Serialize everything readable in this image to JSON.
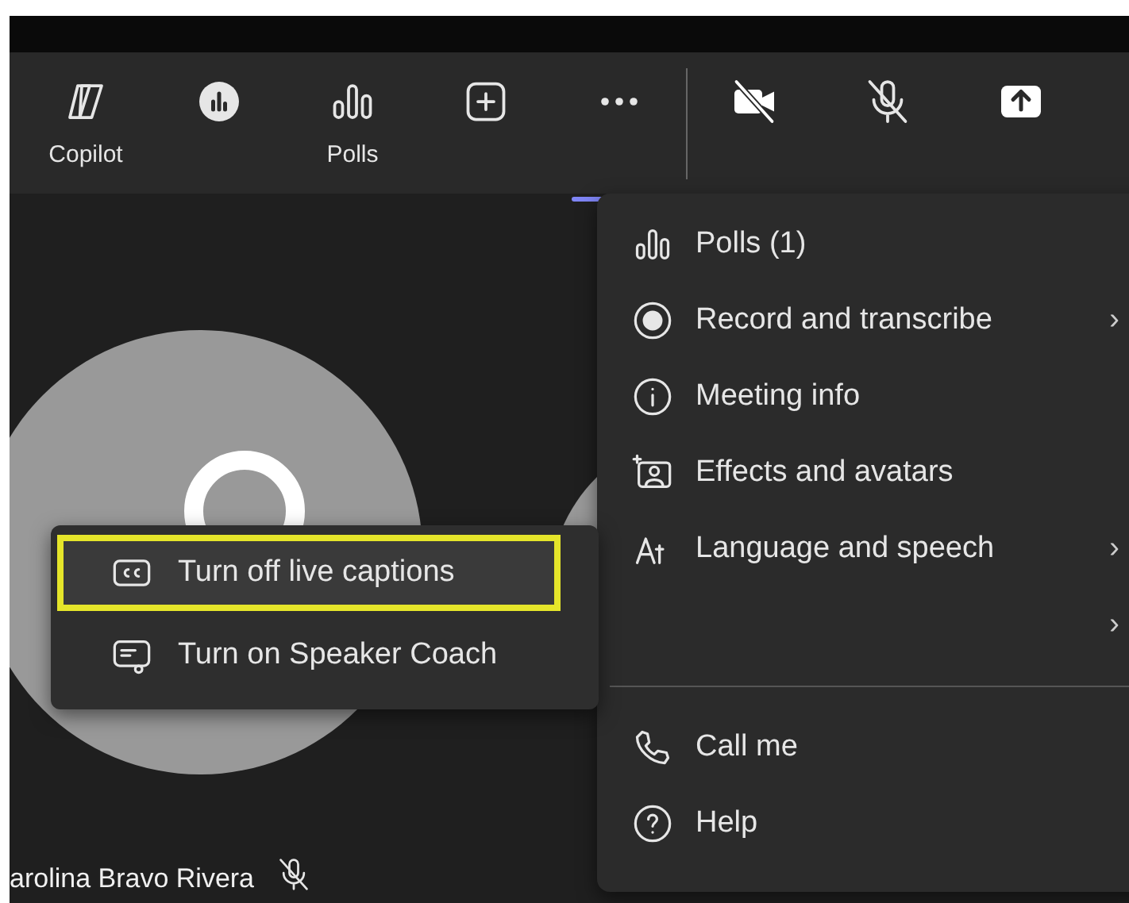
{
  "toolbar": {
    "items": [
      {
        "kind": "copilot",
        "label": "Copilot"
      },
      {
        "kind": "insights"
      },
      {
        "kind": "polls",
        "label": "Polls"
      },
      {
        "kind": "apps"
      },
      {
        "kind": "more",
        "selected": true
      },
      {
        "kind": "separator"
      },
      {
        "kind": "camera-off"
      },
      {
        "kind": "mic-off"
      },
      {
        "kind": "share"
      }
    ]
  },
  "participants": [
    {
      "name": "arolina Bravo Rivera",
      "muted": true
    }
  ],
  "more_menu": {
    "items": [
      {
        "kind": "polls",
        "label": "Polls (1)"
      },
      {
        "kind": "record",
        "label": "Record and transcribe",
        "chevron": "›"
      },
      {
        "kind": "info",
        "label": "Meeting info"
      },
      {
        "kind": "effects",
        "label": "Effects and avatars"
      },
      {
        "kind": "language",
        "label": "Language and speech",
        "chevron": "›"
      },
      {
        "kind": "blank",
        "chevron": "›"
      },
      {
        "kind": "divider"
      },
      {
        "kind": "call",
        "label": "Call me"
      },
      {
        "kind": "help",
        "label": "Help"
      }
    ]
  },
  "submenu": {
    "items": [
      {
        "kind": "cc",
        "label": "Turn off live captions",
        "selected": true
      },
      {
        "kind": "coach",
        "label": "Turn on Speaker Coach",
        "selected": false
      }
    ]
  }
}
